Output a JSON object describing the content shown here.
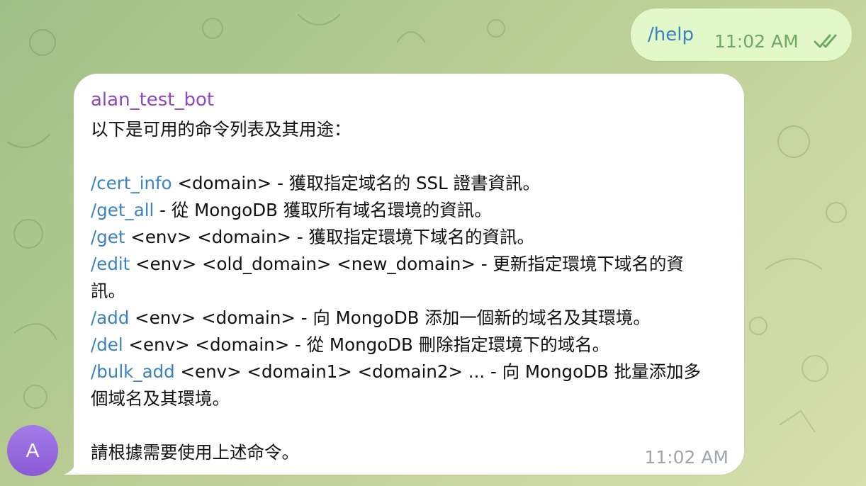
{
  "outgoing": {
    "text": "/help",
    "time": "11:02 AM",
    "status_icon": "double-check-icon"
  },
  "incoming": {
    "sender": "alan_test_bot",
    "intro": "以下是可用的命令列表及其用途：",
    "commands": [
      {
        "cmd": "/cert_info",
        "desc": " <domain> - 獲取指定域名的 SSL 證書資訊。"
      },
      {
        "cmd": "/get_all",
        "desc": " - 從 MongoDB 獲取所有域名環境的資訊。"
      },
      {
        "cmd": "/get",
        "desc": " <env> <domain> - 獲取指定環境下域名的資訊。"
      },
      {
        "cmd": "/edit",
        "desc": " <env> <old_domain> <new_domain> - 更新指定環境下域名的資\n訊。"
      },
      {
        "cmd": "/add",
        "desc": " <env> <domain> - 向 MongoDB 添加一個新的域名及其環境。"
      },
      {
        "cmd": "/del",
        "desc": " <env> <domain> - 從 MongoDB 刪除指定環境下的域名。"
      },
      {
        "cmd": "/bulk_add",
        "desc": " <env> <domain1> <domain2> ... - 向 MongoDB 批量添加多\n個域名及其環境。"
      }
    ],
    "outro": "請根據需要使用上述命令。",
    "time": "11:02 AM"
  },
  "avatar": {
    "letter": "A",
    "color": "#9a6ae0"
  },
  "colors": {
    "link": "#3a82c4",
    "sender": "#8e48c8",
    "outgoing_bg": "#e3f8c8"
  }
}
